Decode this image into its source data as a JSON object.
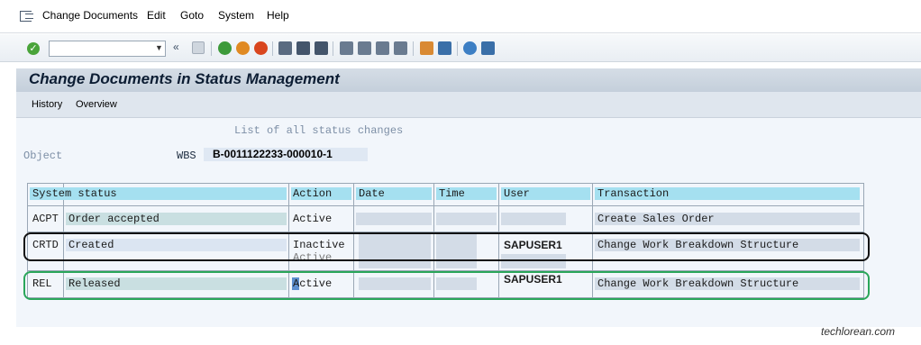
{
  "menu": {
    "items": [
      "Change Documents",
      "Edit",
      "Goto",
      "System",
      "Help"
    ]
  },
  "toolbar": {
    "icons": [
      "enter-icon",
      "command-field",
      "back-icon",
      "save-icon",
      "exit-icon",
      "cancel-icon",
      "print-icon",
      "find-icon",
      "find-next-icon",
      "first-page-icon",
      "previous-page-icon",
      "next-page-icon",
      "last-page-icon",
      "new-session-icon",
      "shortcut-icon",
      "help-icon",
      "layout-icon"
    ]
  },
  "title": "Change Documents in Status Management",
  "app_toolbar": {
    "history": "History",
    "overview": "Overview"
  },
  "list_heading": "List of all status changes",
  "object": {
    "label": "Object",
    "type": "WBS",
    "value": "B-0011122233-000010-1"
  },
  "table": {
    "headers": {
      "system_status": "System status",
      "action": "Action",
      "date": "Date",
      "time": "Time",
      "user": "User",
      "transaction": "Transaction"
    },
    "rows": [
      {
        "code": "ACPT",
        "status": "Order accepted",
        "action": "Active",
        "action2": "",
        "date": "",
        "time": "",
        "user": "",
        "transaction": "Create Sales Order"
      },
      {
        "code": "CRTD",
        "status": "Created",
        "action": "Inactive",
        "action2": "Active",
        "date": "",
        "time": "",
        "user": "SAPUSER1",
        "transaction": "Change Work Breakdown Structure"
      },
      {
        "code": "REL",
        "status": "Released",
        "action": "Active",
        "action2": "",
        "date": "",
        "time": "",
        "user": "SAPUSER1",
        "transaction": "Change Work Breakdown Structure"
      }
    ]
  },
  "watermark": "techlorean.com",
  "colors": {
    "header_cell": "#a5e0f0",
    "title_bar": "#c4cfdb",
    "highlight_crtd": "#111111",
    "highlight_rel": "#2aa65a"
  }
}
